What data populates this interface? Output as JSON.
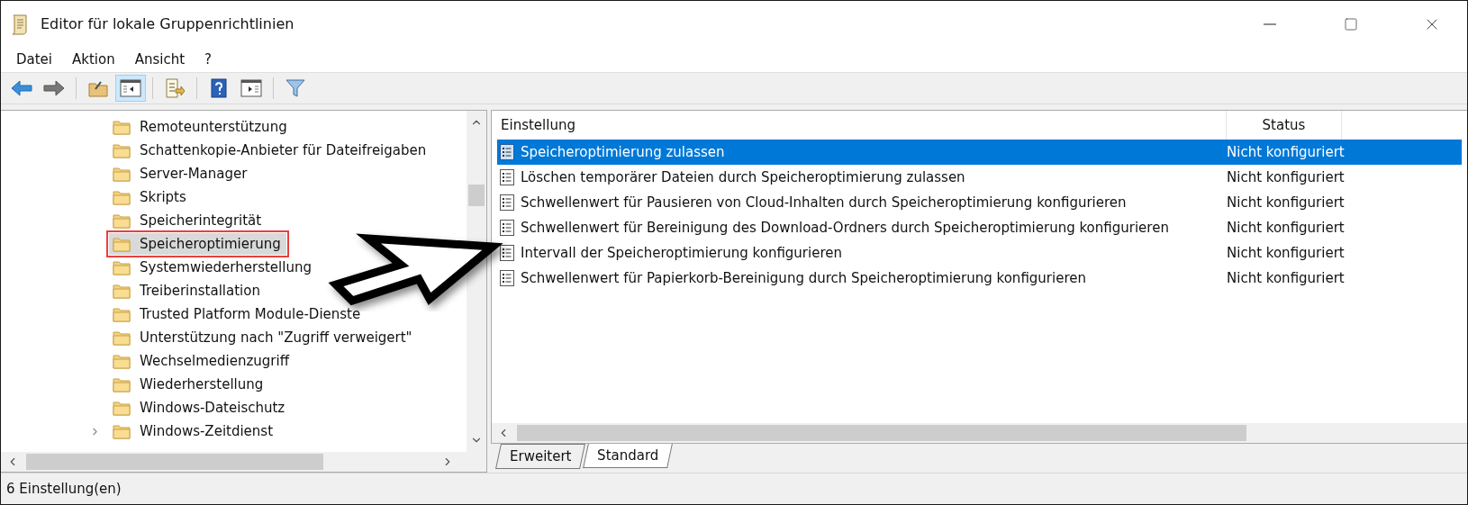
{
  "window": {
    "title": "Editor für lokale Gruppenrichtlinien"
  },
  "menu": [
    "Datei",
    "Aktion",
    "Ansicht",
    "?"
  ],
  "toolbar": [
    [
      {
        "kind": "back",
        "selected": false
      },
      {
        "kind": "forward",
        "selected": false
      }
    ],
    [
      {
        "kind": "up",
        "selected": false
      },
      {
        "kind": "tree",
        "selected": true
      }
    ],
    [
      {
        "kind": "export",
        "selected": false
      }
    ],
    [
      {
        "kind": "help",
        "selected": false
      },
      {
        "kind": "pane",
        "selected": false
      }
    ],
    [
      {
        "kind": "filter",
        "selected": false
      }
    ]
  ],
  "tree": {
    "items": [
      {
        "label": "Remoteunterstützung",
        "selected": false,
        "has_children": false
      },
      {
        "label": "Schattenkopie-Anbieter für Dateifreigaben",
        "selected": false,
        "has_children": false
      },
      {
        "label": "Server-Manager",
        "selected": false,
        "has_children": false
      },
      {
        "label": "Skripts",
        "selected": false,
        "has_children": false
      },
      {
        "label": "Speicherintegrität",
        "selected": false,
        "has_children": false
      },
      {
        "label": "Speicheroptimierung",
        "selected": true,
        "has_children": false
      },
      {
        "label": "Systemwiederherstellung",
        "selected": false,
        "has_children": false
      },
      {
        "label": "Treiberinstallation",
        "selected": false,
        "has_children": false
      },
      {
        "label": "Trusted Platform Module-Dienste",
        "selected": false,
        "has_children": false
      },
      {
        "label": "Unterstützung nach \"Zugriff verweigert\"",
        "selected": false,
        "has_children": false
      },
      {
        "label": "Wechselmedienzugriff",
        "selected": false,
        "has_children": false
      },
      {
        "label": "Wiederherstellung",
        "selected": false,
        "has_children": false
      },
      {
        "label": "Windows-Dateischutz",
        "selected": false,
        "has_children": false
      },
      {
        "label": "Windows-Zeitdienst",
        "selected": false,
        "has_children": true
      }
    ]
  },
  "table": {
    "columns": [
      "Einstellung",
      "Status"
    ],
    "rows": [
      {
        "setting": "Speicheroptimierung zulassen",
        "status": "Nicht konfiguriert",
        "selected": true
      },
      {
        "setting": "Löschen temporärer Dateien durch Speicheroptimierung zulassen",
        "status": "Nicht konfiguriert",
        "selected": false
      },
      {
        "setting": "Schwellenwert für Pausieren von Cloud-Inhalten durch Speicheroptimierung konfigurieren",
        "status": "Nicht konfiguriert",
        "selected": false
      },
      {
        "setting": "Schwellenwert für Bereinigung des Download-Ordners durch Speicheroptimierung konfigurieren",
        "status": "Nicht konfiguriert",
        "selected": false
      },
      {
        "setting": "Intervall der Speicheroptimierung konfigurieren",
        "status": "Nicht konfiguriert",
        "selected": false
      },
      {
        "setting": "Schwellenwert für Papierkorb-Bereinigung durch Speicheroptimierung konfigurieren",
        "status": "Nicht konfiguriert",
        "selected": false
      }
    ]
  },
  "tabs": [
    {
      "label": "Erweitert",
      "selected": false
    },
    {
      "label": "Standard",
      "selected": true
    }
  ],
  "annotation": {
    "kind": "arrow"
  },
  "status_bar": "6 Einstellung(en)"
}
